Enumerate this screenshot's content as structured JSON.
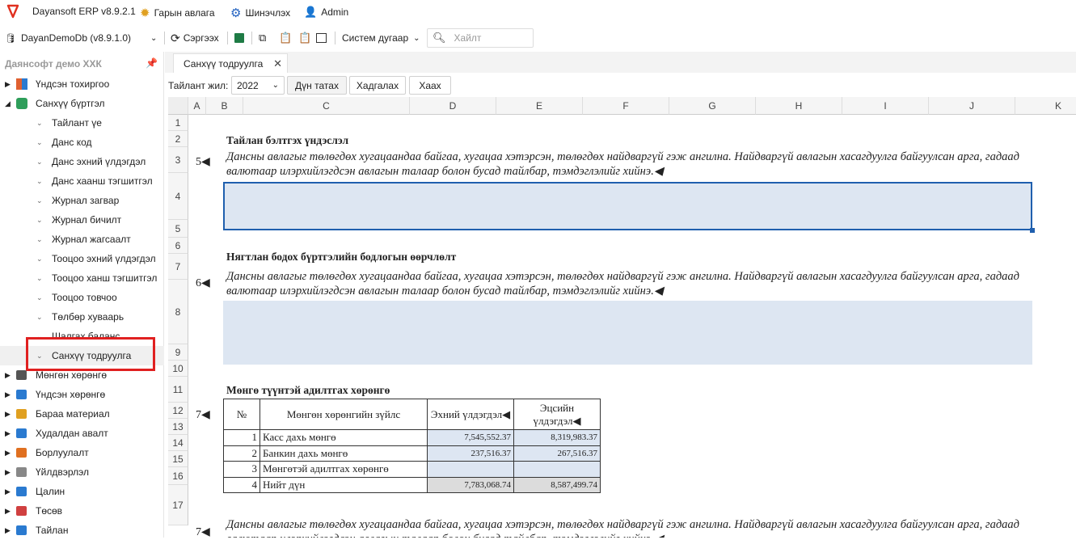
{
  "app": {
    "title": "Dayansoft ERP v8.9.2.1",
    "menu_intro": "Гарын авлага",
    "menu_settings": "Шинэчлэх",
    "user": "Admin"
  },
  "toolbar": {
    "db": "DayanDemoDb (v8.9.1.0)",
    "refresh": "Сэргээх",
    "system_number": "Систем дугаар",
    "search_placeholder": "Хайлт"
  },
  "sidebar": {
    "company": "Даянсофт демо ХХК",
    "items": [
      {
        "label": "Үндсэн тохиргоо",
        "icon": "grid-icon",
        "color": "#e06030"
      },
      {
        "label": "Санхүү бүртгэл",
        "icon": "database-icon",
        "color": "#2e9e5a"
      }
    ],
    "subitems": [
      "Тайлант үе",
      "Данс код",
      "Данс эхний үлдэгдэл",
      "Данс хаанш тэгшитгэл",
      "Журнал загвар",
      "Журнал бичилт",
      "Журнал жагсаалт",
      "Тооцоо эхний үлдэгдэл",
      "Тооцоо ханш тэгшитгэл",
      "Тооцоо товчоо",
      "Төлбөр хуваарь",
      "Шалгах баланс",
      "Санхүү тодруулга"
    ],
    "items2": [
      {
        "label": "Мөнгөн хөрөнгө",
        "icon": "bank-icon"
      },
      {
        "label": "Үндсэн хөрөнгө",
        "icon": "asset-icon"
      },
      {
        "label": "Бараа материал",
        "icon": "box-icon"
      },
      {
        "label": "Худалдан авалт",
        "icon": "truck-icon"
      },
      {
        "label": "Борлуулалт",
        "icon": "cart-icon"
      },
      {
        "label": "Үйлдвэрлэл",
        "icon": "factory-icon"
      },
      {
        "label": "Цалин",
        "icon": "payroll-icon"
      },
      {
        "label": "Төсөв",
        "icon": "budget-icon"
      },
      {
        "label": "Тайлан",
        "icon": "report-icon"
      }
    ]
  },
  "tab": {
    "label": "Санхүү тодруулга"
  },
  "controls": {
    "year_label": "Тайлант жил:",
    "year": "2022",
    "btn_load": "Дүн татах",
    "btn_save": "Хадгалах",
    "btn_close": "Хаах"
  },
  "grid": {
    "columns": [
      "A",
      "B",
      "C",
      "D",
      "E",
      "F",
      "G",
      "H",
      "I",
      "J",
      "K"
    ],
    "rows": [
      "1",
      "2",
      "3",
      "4",
      "5",
      "6",
      "7",
      "8",
      "9",
      "10",
      "11",
      "12",
      "13",
      "14",
      "15",
      "16",
      "17"
    ],
    "sec5_no": "5◀",
    "sec5_title": "Тайлан бэлтгэх үндэслэл",
    "sec5_text": "Дансны авлагыг төлөгдөх хугацаандаа байгаа, хугацаа хэтэрсэн, төлөгдөх найдваргүй гэж ангилна. Найдваргүй авлагын хасагдуулга байгуулсан арга, гадаад валютаар илэрхийлэгдсэн авлагын талаар болон бусад тайлбар, тэмдэглэлийг хийнэ.◀",
    "sec6_no": "6◀",
    "sec6_title": "Нягтлан бодох бүртгэлийн бодлогын өөрчлөлт",
    "sec6_text": "Дансны авлагыг төлөгдөх хугацаандаа байгаа, хугацаа хэтэрсэн, төлөгдөх найдваргүй гэж ангилна. Найдваргүй авлагын хасагдуулга байгуулсан арга, гадаад валютаар илэрхийлэгдсэн авлагын талаар болон бусад тайлбар, тэмдэглэлийг хийнэ.◀",
    "sec7_no": "7◀",
    "sec7_title": "Мөнгө түүнтэй адилтгах хөрөнгө",
    "table": {
      "h_no": "№",
      "h_name": "Мөнгөн хөрөнгийн зүйлс",
      "h_begin": "Эхний үлдэгдэл◀",
      "h_end": "Эцсийн үлдэгдэл◀",
      "rows": [
        {
          "no": "1",
          "name": "Касс дахь мөнгө",
          "begin": "7,545,552.37",
          "end": "8,319,983.37"
        },
        {
          "no": "2",
          "name": "Банкин дахь мөнгө",
          "begin": "237,516.37",
          "end": "267,516.37"
        },
        {
          "no": "3",
          "name": "Мөнгөтэй адилтгах хөрөнгө",
          "begin": "",
          "end": ""
        },
        {
          "no": "4",
          "name": "Нийт дүн",
          "begin": "7,783,068.74",
          "end": "8,587,499.74"
        }
      ]
    },
    "sec8_no": "7◀",
    "sec8_text": "Дансны авлагыг төлөгдөх хугацаандаа байгаа, хугацаа хэтэрсэн, төлөгдөх найдваргүй гэж ангилна. Найдваргүй авлагын хасагдуулга байгуулсан арга, гадаад валютаар илэрхийлэгдсэн авлагын талаар болон бусад тайлбар, тэмдэглэлийг хийнэ.◀"
  },
  "colors": {
    "accent": "#1f5fae",
    "highlight": "#e02020",
    "fill": "#dde6f2"
  }
}
